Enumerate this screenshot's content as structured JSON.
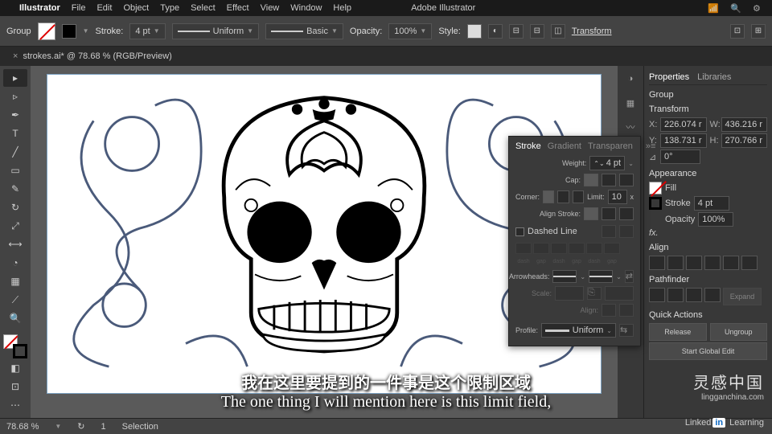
{
  "menubar": {
    "apple": "",
    "app": "Illustrator",
    "items": [
      "File",
      "Edit",
      "Object",
      "Type",
      "Select",
      "Effect",
      "View",
      "Window",
      "Help"
    ],
    "title": "Adobe Illustrator"
  },
  "controlbar": {
    "selection": "Group",
    "stroke_label": "Stroke:",
    "stroke_weight": "4 pt",
    "uniform": "Uniform",
    "basic": "Basic",
    "opacity_label": "Opacity:",
    "opacity": "100%",
    "style_label": "Style:",
    "transform": "Transform"
  },
  "tab": {
    "name": "strokes.ai* @ 78.68 % (RGB/Preview)",
    "close": "×"
  },
  "tools": [
    "▲",
    "▽",
    "✒",
    "T",
    "/",
    "◯",
    "↗",
    "◐",
    "⬚",
    "✂",
    "◉",
    "⊞",
    "✎",
    "🔍",
    "⋯"
  ],
  "strokepanel": {
    "tabs": [
      "Stroke",
      "Gradient",
      "Transparen"
    ],
    "weight_label": "Weight:",
    "weight": "4 pt",
    "cap_label": "Cap:",
    "corner_label": "Corner:",
    "limit_label": "Limit:",
    "limit": "10",
    "align_label": "Align Stroke:",
    "dashed": "Dashed Line",
    "dash_labels": [
      "dash",
      "gap",
      "dash",
      "gap",
      "dash",
      "gap"
    ],
    "arrowheads_label": "Arrowheads:",
    "scale_label": "Scale:",
    "align_arrow_label": "Align:",
    "profile_label": "Profile:",
    "profile": "Uniform"
  },
  "props": {
    "tabs": [
      "Properties",
      "Libraries"
    ],
    "selection": "Group",
    "transform": {
      "title": "Transform",
      "x": "226.074 r",
      "w": "436.216 r",
      "y": "138.731 r",
      "h": "270.766 r",
      "angle": "0°"
    },
    "appearance": {
      "title": "Appearance",
      "fill": "Fill",
      "stroke": "Stroke",
      "stroke_val": "4 pt",
      "opacity": "Opacity",
      "opacity_val": "100%",
      "fx": "fx."
    },
    "align": {
      "title": "Align"
    },
    "pathfinder": {
      "title": "Pathfinder",
      "expand": "Expand"
    },
    "quick": {
      "title": "Quick Actions",
      "release": "Release",
      "ungroup": "Ungroup",
      "global": "Start Global Edit"
    }
  },
  "status": {
    "zoom": "78.68 %",
    "tool": "Selection"
  },
  "caption": {
    "line1": "我在这里要提到的一件事是这个限制区域",
    "line2": "The one thing I will mention here is this limit field,"
  },
  "watermark": {
    "brand": "灵感中国",
    "url": "lingganchina.com"
  },
  "linkedin": {
    "text1": "Linked",
    "box": "in",
    "text2": " Learning"
  }
}
